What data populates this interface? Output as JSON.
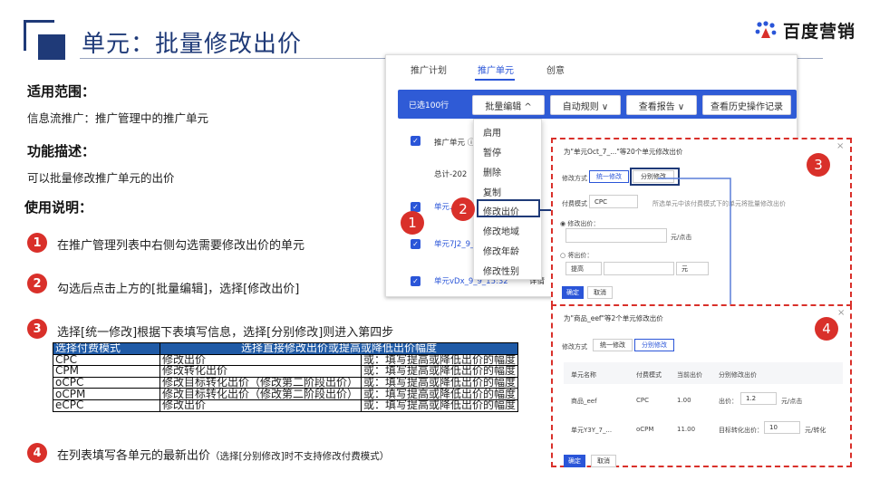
{
  "header": {
    "title": "单元：批量修改出价",
    "logo_text": "百度营销"
  },
  "scope": {
    "heading": "适用范围：",
    "text": "信息流推广：推广管理中的推广单元"
  },
  "feature": {
    "heading": "功能描述：",
    "text": "可以批量修改推广单元的出价"
  },
  "usage": {
    "heading": "使用说明："
  },
  "steps": [
    {
      "num": "1",
      "text": "在推广管理列表中右侧勾选需要修改出价的单元"
    },
    {
      "num": "2",
      "text": "勾选后点击上方的[批量编辑]，选择[修改出价]"
    },
    {
      "num": "3",
      "text": "选择[统一修改]根据下表填写信息，选择[分别修改]则进入第四步"
    },
    {
      "num": "4",
      "text": "在列表填写各单元的最新出价",
      "note": "（选择[分别修改]时不支持修改付费模式）"
    }
  ],
  "table": {
    "headers": [
      "选择付费模式",
      "选择直接修改出价或提高或降低出价幅度"
    ],
    "rows": [
      [
        "CPC",
        "修改出价",
        "或：填写提高或降低出价的幅度"
      ],
      [
        "CPM",
        "修改转化出价",
        "或：填写提高或降低出价的幅度"
      ],
      [
        "oCPC",
        "修改目标转化出价（修改第二阶段出价）",
        "或：填写提高或降低出价的幅度"
      ],
      [
        "oCPM",
        "修改目标转化出价（修改第二阶段出价）",
        "或：填写提高或降低出价的幅度"
      ],
      [
        "eCPC",
        "修改出价",
        "或：填写提高或降低出价的幅度"
      ]
    ]
  },
  "shotA": {
    "tabs": [
      "推广计划",
      "推广单元",
      "创意"
    ],
    "selected": "已选100行",
    "buttons": [
      "批量编辑 ^",
      "自动规则 ∨",
      "查看报告 ∨",
      "查看历史操作记录"
    ],
    "col_header": "推广单元 ⓘ",
    "total": "总计-202",
    "rows": [
      "单元…",
      "单元7J2_9_9…",
      "单元vDx_9_9_15:32"
    ],
    "row_extra": "详情",
    "menu": [
      "启用",
      "暂停",
      "删除",
      "复制",
      "修改出价",
      "修改地域",
      "修改年龄",
      "修改性别"
    ]
  },
  "dialog3": {
    "title": "为\"单元Oct_7_...\"等20个单元修改出价",
    "mode_label": "修改方式",
    "mode_unified": "统一修改",
    "mode_separate": "分别修改",
    "pay_label": "付费模式",
    "pay_value": "CPC",
    "pay_hint": "所选单元中该付费模式下的单元将批量修改出价",
    "radio1": "修改出价：",
    "unit1": "元/点击",
    "radio2": "将出价：",
    "raise": "提高",
    "unit2": "元",
    "ok": "确定",
    "cancel": "取消"
  },
  "dialog4": {
    "title": "为\"商品_eef\"等2个单元修改出价",
    "mode_label": "修改方式",
    "mode_unified": "统一修改",
    "mode_separate": "分别修改",
    "cols": [
      "单元名称",
      "付费模式",
      "当前出价",
      "分别修改出价"
    ],
    "rows": [
      {
        "name": "商品_eef",
        "mode": "CPC",
        "price": "1.00",
        "label": "出价：",
        "value": "1.2",
        "unit": "元/点击"
      },
      {
        "name": "单元Y3Y_7_...",
        "mode": "oCPM",
        "price": "11.00",
        "label": "目标转化出价：",
        "value": "10",
        "unit": "元/转化"
      }
    ],
    "ok": "确定",
    "cancel": "取消"
  },
  "markers": [
    "1",
    "2",
    "3",
    "4"
  ],
  "colors": {
    "brand": "#1f3a78",
    "accent": "#2a55d8",
    "marker": "#d9302a",
    "table_header": "#1f5aa6"
  }
}
